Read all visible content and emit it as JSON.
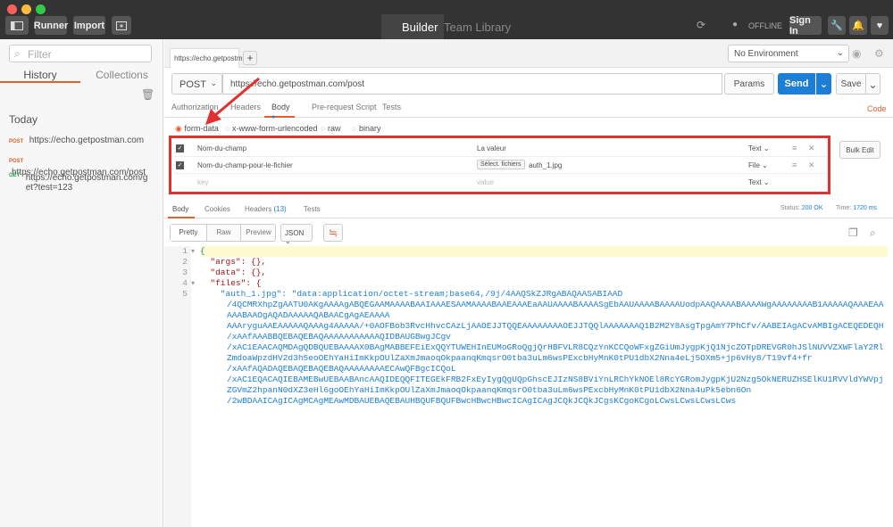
{
  "titlebar": {
    "runner_label": "Runner",
    "import_label": "Import",
    "builder_label": "Builder",
    "team_library_label": "Team Library",
    "offline_label": "OFFLINE",
    "signin_label": "Sign In"
  },
  "sidebar": {
    "filter_placeholder": "Filter",
    "tabs": [
      "History",
      "Collections"
    ],
    "section": "Today",
    "items": [
      {
        "method": "POST",
        "url": "https://echo.getpostman.com"
      },
      {
        "method": "POST",
        "url": "https://echo.getpostman.com/post"
      },
      {
        "method": "GET",
        "url": "https://echo.getpostman.com/get?test=123"
      }
    ]
  },
  "main": {
    "tab_label": "https://echo.getpostm",
    "environment": "No Environment",
    "method": "POST",
    "url": "https://echo.getpostman.com/post",
    "params_label": "Params",
    "send_label": "Send",
    "save_label": "Save",
    "req_tabs": [
      "Authorization",
      "Headers",
      "Body",
      "Pre-request Script",
      "Tests"
    ],
    "code_label": "Code",
    "body_types": [
      "form-data",
      "x-www-form-urlencoded",
      "raw",
      "binary"
    ],
    "form_rows": [
      {
        "key": "Nom-du-champ",
        "value": "La valeur",
        "type": "Text"
      },
      {
        "key": "Nom-du-champ-pour-le-fichier",
        "file_button": "Sélect. fichiers",
        "value": "auth_1.jpg",
        "type": "File"
      },
      {
        "key": "key",
        "value": "value",
        "type": "Text"
      }
    ],
    "bulk_edit": "Bulk Edit",
    "resp_tabs": [
      "Body",
      "Cookies",
      "Headers",
      "(13)",
      "Tests"
    ],
    "status_label": "Status:",
    "status_value": "200 OK",
    "time_label": "Time:",
    "time_value": "1720 ms",
    "view_modes": [
      "Pretty",
      "Raw",
      "Preview"
    ],
    "format": "JSON",
    "code_lines": [
      "{",
      "  \"args\": {},",
      "  \"data\": {},",
      "  \"files\": {",
      "    \"auth_1.jpg\": \"data:application/octet-stream;base64,/9j/4AAQSkZJRgABAQAASABIAAD",
      "/4QCMRXhpZgAATU0AKgAAAAgABQEGAAMAAAABAAIAAAESAAMAAAABAAEAAAEaAAUAAAABAAAASgEbAAUAAAABAAAAUodpAAQAAAABAAAAWgAAAAAAAAB1AAAAAQAAAEAAAAABAAOgAQADAAAAAQABAACgAgAEAAAA",
      "AAAryguAAEAAAAAQAAAg4AAAAA/+0AOFBob3RvcHhvcCAzLjAAOEJJTQQEAAAAAAAAOEJJTQQlAAAAAAAQ1B2M2Y8AsgTpgAmY7PhCfv/AABEIAgACvAMBIgACEQEDEQH",
      "/xAAfAAABBQEBAQEBAQAAAAAAAAAAAQIDBAUGBwgJCgv",
      "/xAC1EAACAQMDAgQDBQUEBAAAAX0BAgMABBEFEiExQQYTUWEHInEUMoGRoQgjQrHBFVLR8CQzYnKCCQoWFxgZGiUmJygpKjQ1NjcZOTpDREVGR0hJSlNUVVZXWFlaY2RlZmdoaWpzdHV2d3h5eoOEhYaHiImKkpOUlZaXmJmaoqOkpaanqKmqsrO0tba3uLm6wsPExcbHyMnK0tPU1dbX2Nna4eLj5OXm5+jp6vHy8/T19vf4+fr",
      "/xAAfAQADAQEBAQEBAQEBAQAAAAAAAAECAwQFBgcICQoL",
      "/xAC1EQACAQIEBAMEBwUEBAABAncAAQIDEQQFITEGEkFRB2FxEyIygQgUQpGhscEJIzNS8BViYnLRChYkNOEl8RcYGRomJygpKjU2Nzg5OkNERUZHSElKU1RVVldYWVpjZGVmZ2hpanN0dXZ3eHl6goOEhYaHiImKkpOUlZaXmJmaoqOkpaanqKmqsrO0tba3uLm6wsPExcbHyMnK0tPU1dbX2Nna4uPk5ebn6On",
      "/2wBDAAICAgICAgMCAgMEAwMDBAUEBAQEBAUHBQUFBQUFBwcHBwcHBwcICAgICAgJCQkJCQkJCgsKCgoKCgoLCwsLCwsLCwsLCws"
    ]
  }
}
